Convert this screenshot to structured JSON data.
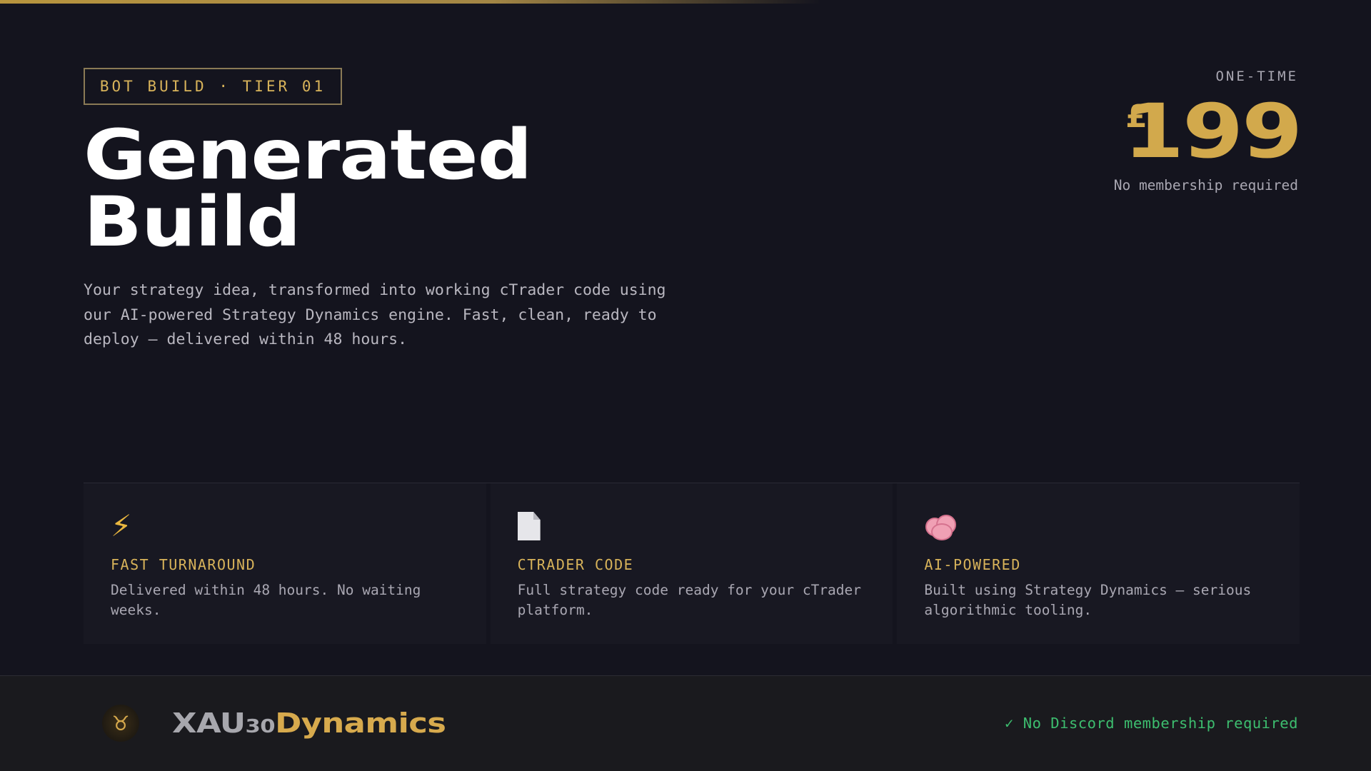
{
  "badge": {
    "label": "BOT BUILD · TIER 01"
  },
  "hero": {
    "title_line1": "Generated",
    "title_line2": "Build",
    "description": "Your strategy idea, transformed into working cTrader code using our AI-powered Strategy Dynamics engine. Fast, clean, ready to deploy — delivered within 48 hours."
  },
  "pricing": {
    "label": "ONE-TIME",
    "currency": "£",
    "amount": "199",
    "note": "No membership required"
  },
  "features": [
    {
      "icon": "lightning-bolt-icon",
      "title": "FAST TURNAROUND",
      "text": "Delivered within 48 hours. No waiting weeks."
    },
    {
      "icon": "document-icon",
      "title": "CTRADER CODE",
      "text": "Full strategy code ready for your cTrader platform."
    },
    {
      "icon": "brain-icon",
      "title": "AI-POWERED",
      "text": "Built using Strategy Dynamics — serious algorithmic tooling."
    }
  ],
  "footer": {
    "brand_part1": "XAU",
    "brand_part2": "30",
    "brand_part3": "Dynamics",
    "logo_icon": "bull-logo-icon",
    "discord_note": "✓ No Discord membership required"
  },
  "colors": {
    "accent_gold": "#d2a94c",
    "background": "#14141e",
    "success_green": "#3dbe6f"
  }
}
